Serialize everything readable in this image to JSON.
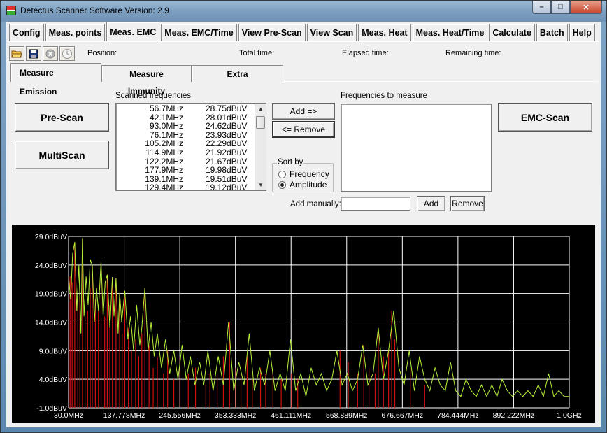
{
  "window": {
    "title": "Detectus Scanner Software Version: 2.9",
    "buttons": {
      "minimize": "–",
      "maximize": "□",
      "close": "✕"
    }
  },
  "top_tabs": [
    {
      "label": "Config",
      "active": false
    },
    {
      "label": "Meas. points",
      "active": false
    },
    {
      "label": "Meas. EMC",
      "active": true
    },
    {
      "label": "Meas. EMC/Time",
      "active": false
    },
    {
      "label": "View Pre-Scan",
      "active": false
    },
    {
      "label": "View Scan",
      "active": false
    },
    {
      "label": "Meas. Heat",
      "active": false
    },
    {
      "label": "Meas. Heat/Time",
      "active": false
    },
    {
      "label": "Calculate",
      "active": false
    },
    {
      "label": "Batch",
      "active": false
    },
    {
      "label": "Help",
      "active": false
    }
  ],
  "toolbar": {
    "icons": [
      "open-folder-icon",
      "save-icon",
      "stop-icon",
      "clock-icon"
    ],
    "position_label": "Position:",
    "total_time_label": "Total time:",
    "elapsed_time_label": "Elapsed time:",
    "remaining_time_label": "Remaining time:"
  },
  "sub_tabs": [
    {
      "label": "Measure Emission",
      "active": true
    },
    {
      "label": "Measure Immunity",
      "active": false
    },
    {
      "label": "Extra",
      "active": false
    }
  ],
  "buttons": {
    "pre_scan": "Pre-Scan",
    "multi_scan": "MultiScan",
    "emc_scan": "EMC-Scan",
    "add": "Add =>",
    "remove": "<= Remove",
    "add_manual": "Add",
    "remove_manual": "Remove"
  },
  "scanned": {
    "label": "Scanned frequencies",
    "rows": [
      {
        "freq": "56.7MHz",
        "amp": "28.75dBuV"
      },
      {
        "freq": "42.1MHz",
        "amp": "28.01dBuV"
      },
      {
        "freq": "93.0MHz",
        "amp": "24.62dBuV"
      },
      {
        "freq": "76.1MHz",
        "amp": "23.93dBuV"
      },
      {
        "freq": "105.2MHz",
        "amp": "22.29dBuV"
      },
      {
        "freq": "114.9MHz",
        "amp": "21.92dBuV"
      },
      {
        "freq": "122.2MHz",
        "amp": "21.67dBuV"
      },
      {
        "freq": "177.9MHz",
        "amp": "19.98dBuV"
      },
      {
        "freq": "139.1MHz",
        "amp": "19.51dBuV"
      },
      {
        "freq": "129.4MHz",
        "amp": "19.12dBuV"
      }
    ]
  },
  "measure": {
    "label": "Frequencies to measure"
  },
  "sort_by": {
    "label": "Sort by",
    "options": [
      {
        "label": "Frequency",
        "checked": false
      },
      {
        "label": "Amplitude",
        "checked": true
      }
    ]
  },
  "add_manually": {
    "label": "Add manually:",
    "value": ""
  },
  "colors": {
    "trace": "#b7f03a",
    "peaks": "#d01010",
    "grid": "#ffffff",
    "background": "#000000"
  },
  "chart_data": {
    "type": "line",
    "title": "",
    "xlabel": "",
    "ylabel": "",
    "xlim_mhz": [
      30.0,
      1000.0
    ],
    "ylim": [
      -1.0,
      29.0
    ],
    "y_ticks": [
      "29.0dBuV",
      "24.0dBuV",
      "19.0dBuV",
      "14.0dBuV",
      "9.0dBuV",
      "4.0dBuV",
      "-1.0dBuV"
    ],
    "x_ticks": [
      "30.0MHz",
      "137.778MHz",
      "245.556MHz",
      "353.333MHz",
      "461.111MHz",
      "568.889MHz",
      "676.667MHz",
      "784.444MHz",
      "892.222MHz",
      "1.0GHz"
    ],
    "grid": true,
    "series": [
      {
        "kind": "trace",
        "x": [
          30,
          34,
          38,
          42,
          46,
          50,
          54,
          57,
          60,
          64,
          68,
          72,
          76,
          80,
          84,
          88,
          93,
          97,
          101,
          105,
          110,
          115,
          118,
          122,
          126,
          129,
          133,
          139,
          145,
          150,
          156,
          162,
          168,
          172,
          178,
          184,
          190,
          196,
          202,
          210,
          218,
          226,
          234,
          242,
          250,
          258,
          266,
          275,
          284,
          292,
          300,
          310,
          320,
          330,
          340,
          350,
          360,
          370,
          380,
          390,
          400,
          410,
          420,
          430,
          440,
          450,
          460,
          470,
          480,
          490,
          500,
          510,
          520,
          530,
          540,
          550,
          560,
          570,
          580,
          590,
          600,
          610,
          620,
          630,
          640,
          650,
          660,
          670,
          680,
          690,
          700,
          710,
          720,
          730,
          740,
          750,
          760,
          770,
          780,
          790,
          800,
          810,
          820,
          830,
          840,
          850,
          860,
          870,
          880,
          890,
          900,
          910,
          920,
          930,
          940,
          950,
          960,
          970,
          980,
          990,
          1000
        ],
        "y": [
          22,
          18,
          26,
          28,
          16,
          24,
          12,
          28.7,
          15,
          22,
          17,
          25,
          23.9,
          14,
          20,
          16,
          24.6,
          15,
          21,
          22.3,
          13,
          21.9,
          15,
          21.7,
          12,
          19.1,
          14,
          19.5,
          11,
          15,
          9,
          17,
          10,
          13,
          20,
          9,
          14,
          8,
          12,
          6,
          11,
          5,
          9,
          4,
          10,
          4,
          8,
          3,
          7,
          3,
          9,
          2,
          8,
          3,
          14,
          2,
          7,
          3,
          12,
          2,
          6,
          3,
          9,
          2,
          5,
          2,
          11,
          2,
          5,
          1,
          6,
          3,
          5,
          2,
          4,
          9,
          3,
          5,
          2,
          4,
          10,
          3,
          5,
          13,
          4,
          9,
          16,
          6,
          3,
          9,
          2,
          8,
          4,
          2,
          6,
          3,
          2,
          7,
          2,
          1,
          4,
          2,
          1,
          3,
          1,
          3,
          1,
          4,
          2,
          1,
          2,
          1,
          2,
          1,
          3,
          1,
          5,
          1,
          2,
          1,
          1
        ]
      },
      {
        "kind": "peaks",
        "x": [
          33,
          37,
          42,
          48,
          52,
          57,
          62,
          67,
          72,
          76,
          82,
          88,
          93,
          100,
          105,
          110,
          115,
          122,
          129,
          134,
          139,
          146,
          152,
          160,
          166,
          172,
          178,
          186,
          194,
          202,
          214,
          222,
          234,
          246,
          262,
          276,
          296,
          304,
          318,
          330,
          342,
          354,
          364,
          376,
          386,
          402,
          412,
          426,
          442,
          462,
          474,
          556,
          572,
          590,
          602,
          612,
          624,
          630,
          640,
          650,
          656,
          662,
          692,
          720
        ],
        "y": [
          22,
          21,
          28,
          19,
          20,
          28.7,
          15,
          16,
          20,
          23.9,
          18,
          16,
          24.6,
          15,
          22.3,
          17,
          21.9,
          21.7,
          19.1,
          12,
          19.5,
          13,
          9,
          11,
          8,
          12,
          20,
          10,
          6,
          8,
          5,
          9,
          4,
          8,
          5,
          6,
          3,
          5,
          5,
          8,
          14,
          6,
          5,
          8,
          4,
          6,
          5,
          6,
          4,
          5,
          4,
          9,
          7,
          5,
          10,
          6,
          5,
          13,
          8,
          9,
          16,
          11,
          6,
          3
        ]
      }
    ]
  }
}
